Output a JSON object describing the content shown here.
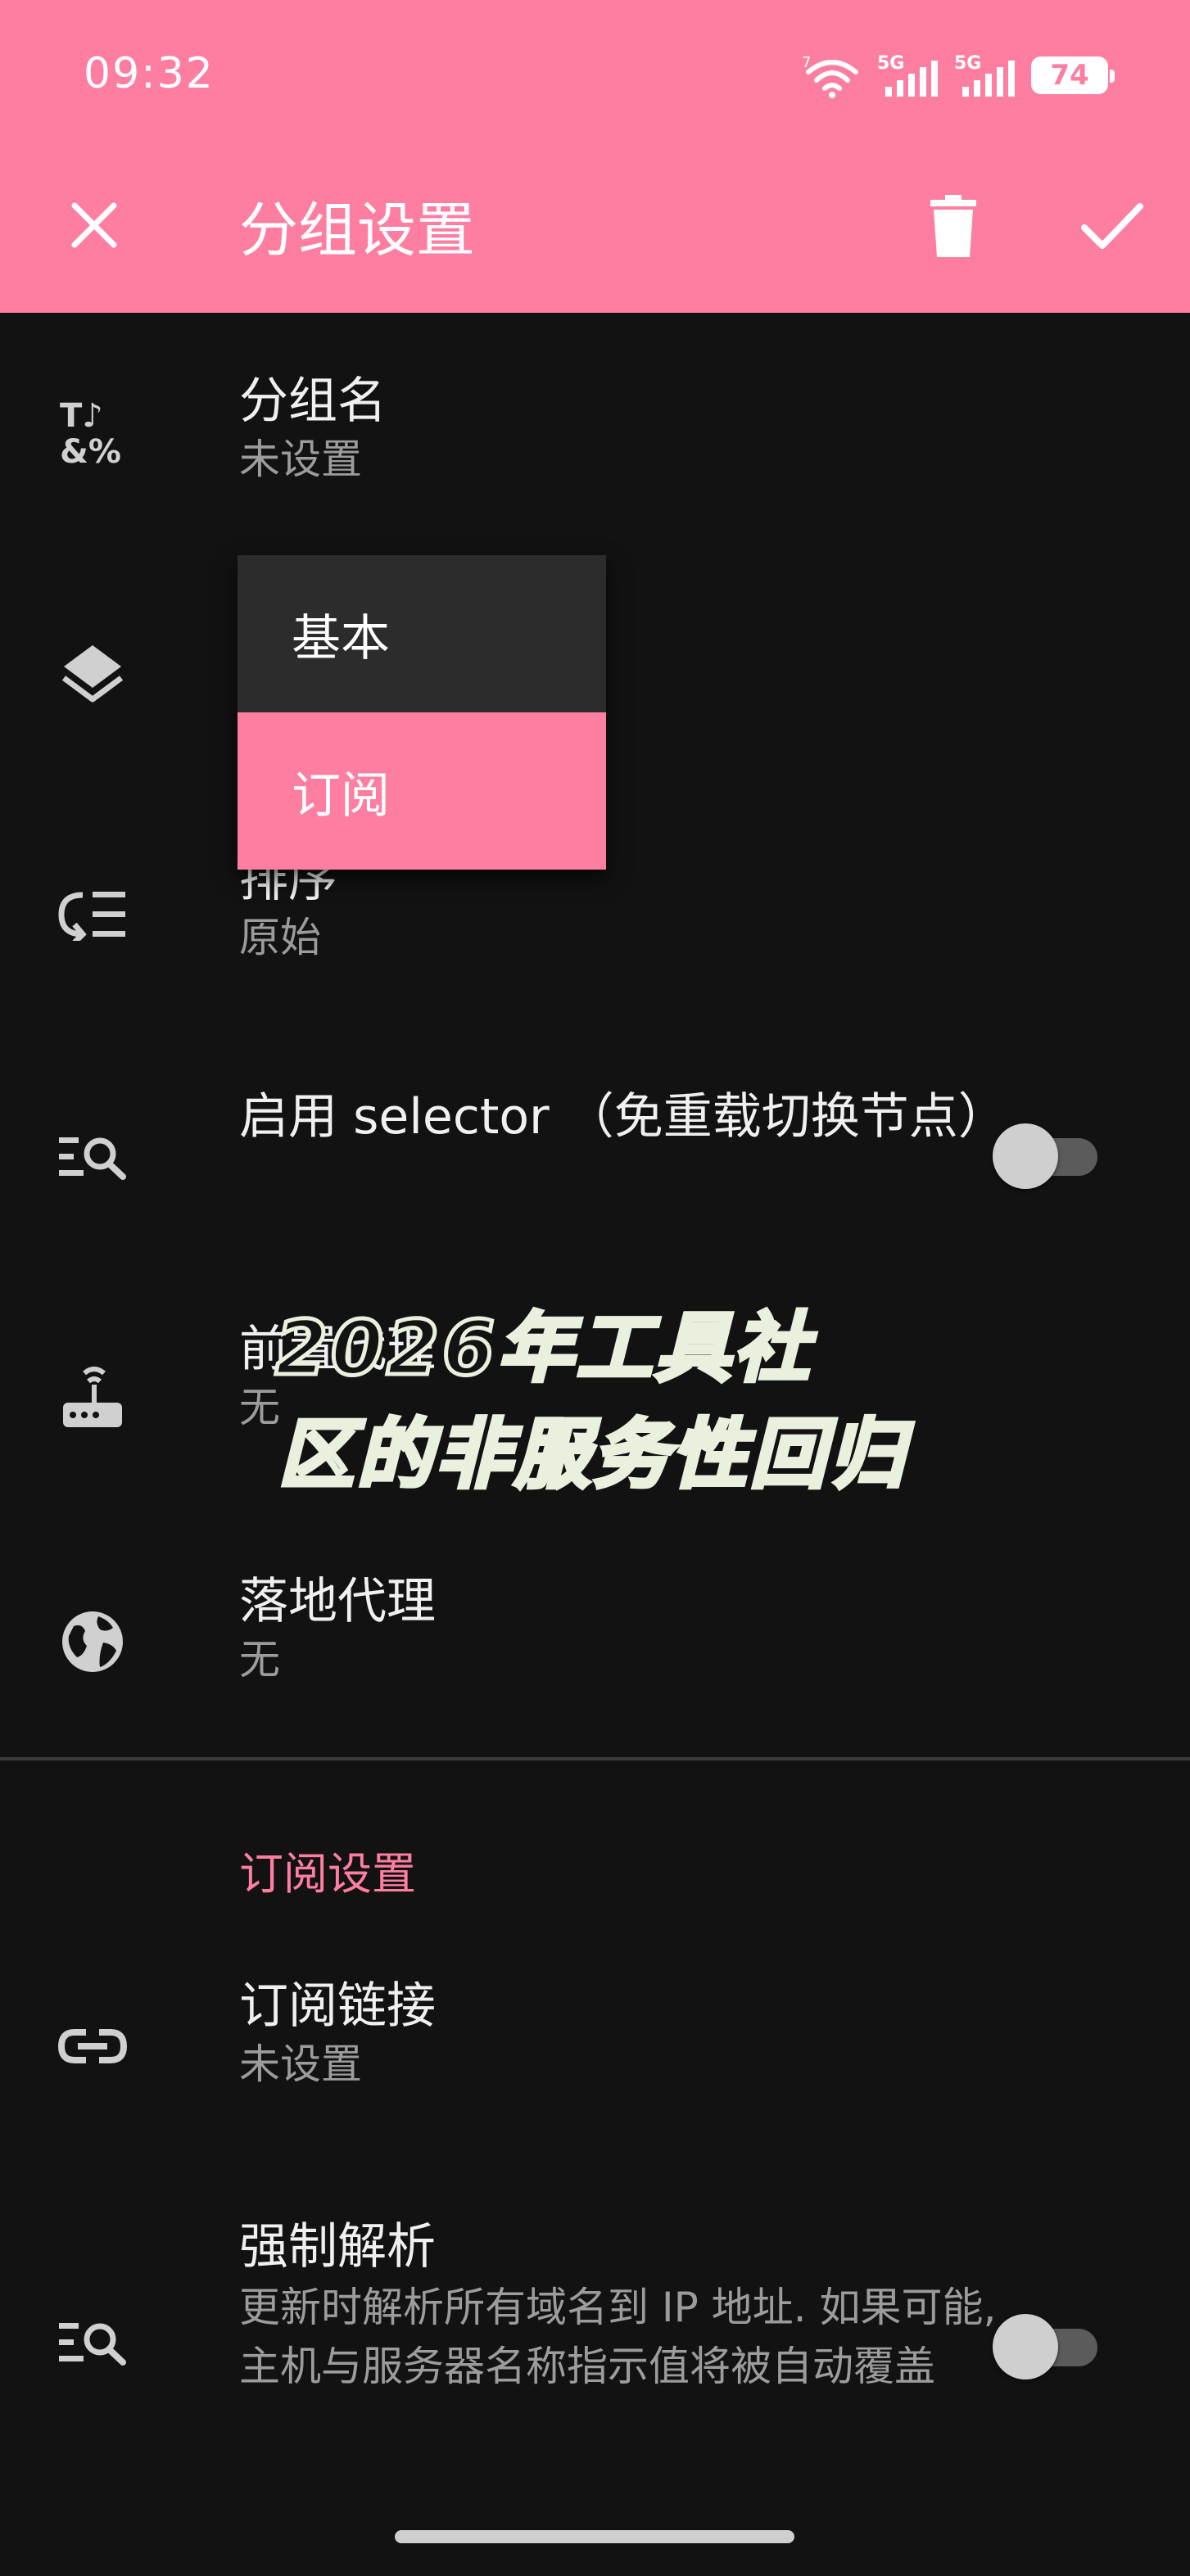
{
  "status_bar": {
    "time": "09:32",
    "wifi_badge": "7",
    "signal_1": "5G",
    "signal_2": "5G",
    "battery": "74"
  },
  "app_bar": {
    "title": "分组设置",
    "close_icon": "close-icon",
    "delete_icon": "trash-icon",
    "save_icon": "check-icon"
  },
  "settings": {
    "group_name": {
      "icon": "text-format-icon",
      "title": "分组名",
      "value": "未设置"
    },
    "group_type": {
      "icon": "layers-icon"
    },
    "sort": {
      "icon": "sort-list-icon",
      "title": "排序",
      "value": "原始"
    },
    "selector": {
      "icon": "list-search-icon",
      "title": "启用 selector （免重载切换节点）",
      "enabled": false
    },
    "front_proxy": {
      "icon": "router-icon",
      "title": "前置代理",
      "value": "无"
    },
    "landing_proxy": {
      "icon": "globe-icon",
      "title": "落地代理",
      "value": "无"
    }
  },
  "subscription_section": {
    "header": "订阅设置",
    "link": {
      "icon": "link-icon",
      "title": "订阅链接",
      "value": "未设置"
    },
    "force_resolve": {
      "icon": "list-search-icon",
      "title": "强制解析",
      "description": "更新时解析所有域名到 IP 地址. 如果可能, 主机与服务器名称指示值将被自动覆盖",
      "enabled": false
    }
  },
  "type_dropdown": {
    "options": [
      "基本",
      "订阅"
    ],
    "selected_index": 1
  },
  "watermark": {
    "line1": "2026年工具社",
    "line2": "区的非服务性回归"
  },
  "colors": {
    "accent": "#fd7ea1",
    "background": "#121212",
    "menu_background": "#2c2c2c"
  }
}
